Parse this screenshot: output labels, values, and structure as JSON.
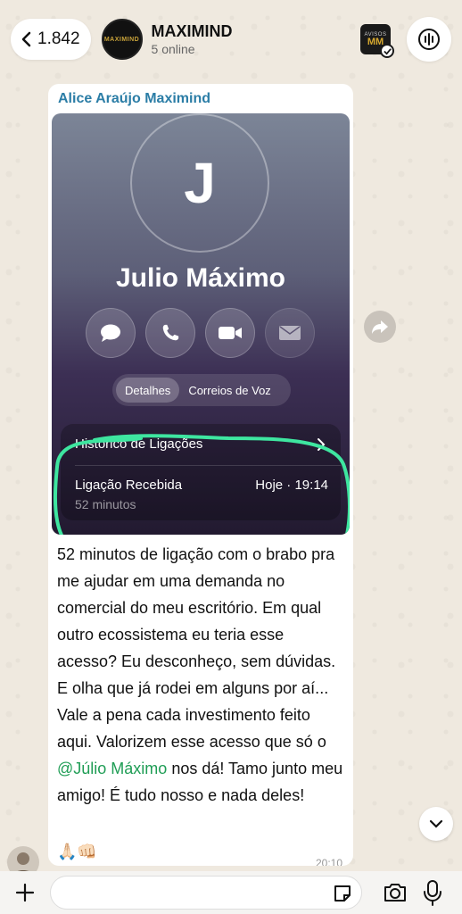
{
  "header": {
    "back_count": "1.842",
    "group_name": "MAXIMIND",
    "group_status": "5 online",
    "group_avatar_text": "MAXIMIND",
    "avisos_label": "AVISOS",
    "avisos_logo": "MM"
  },
  "message": {
    "sender": "Alice Araújo Maximind",
    "screenshot": {
      "avatar_letter": "J",
      "contact_name": "Julio Máximo",
      "action_icons": [
        "message-icon",
        "phone-icon",
        "video-icon",
        "mail-icon"
      ],
      "tabs": [
        "Detalhes",
        "Correios de Voz"
      ],
      "history_label": "Histórico de Ligações",
      "call_type": "Ligação Recebida",
      "call_time": "Hoje · 19:14",
      "call_duration": "52 minutos"
    },
    "text_before_mention": "52 minutos de ligação com o brabo pra me ajudar em uma demanda no comercial do meu escritório. Em qual outro ecossistema eu teria esse acesso? Eu desconheço, sem dúvidas. E olha que já rodei em alguns por aí... Vale a pena cada investimento feito aqui. Valorizem esse acesso que só o ",
    "mention": "@Júlio Máximo",
    "text_after_mention": " nos dá! Tamo junto meu amigo! É tudo nosso e nada deles!",
    "emojis": "🙏🏻👊🏻",
    "time": "20:10"
  },
  "composer": {
    "placeholder": ""
  },
  "colors": {
    "highlight": "#3ee6a0",
    "sender": "#2b7da6",
    "mention": "#1f9d55"
  }
}
